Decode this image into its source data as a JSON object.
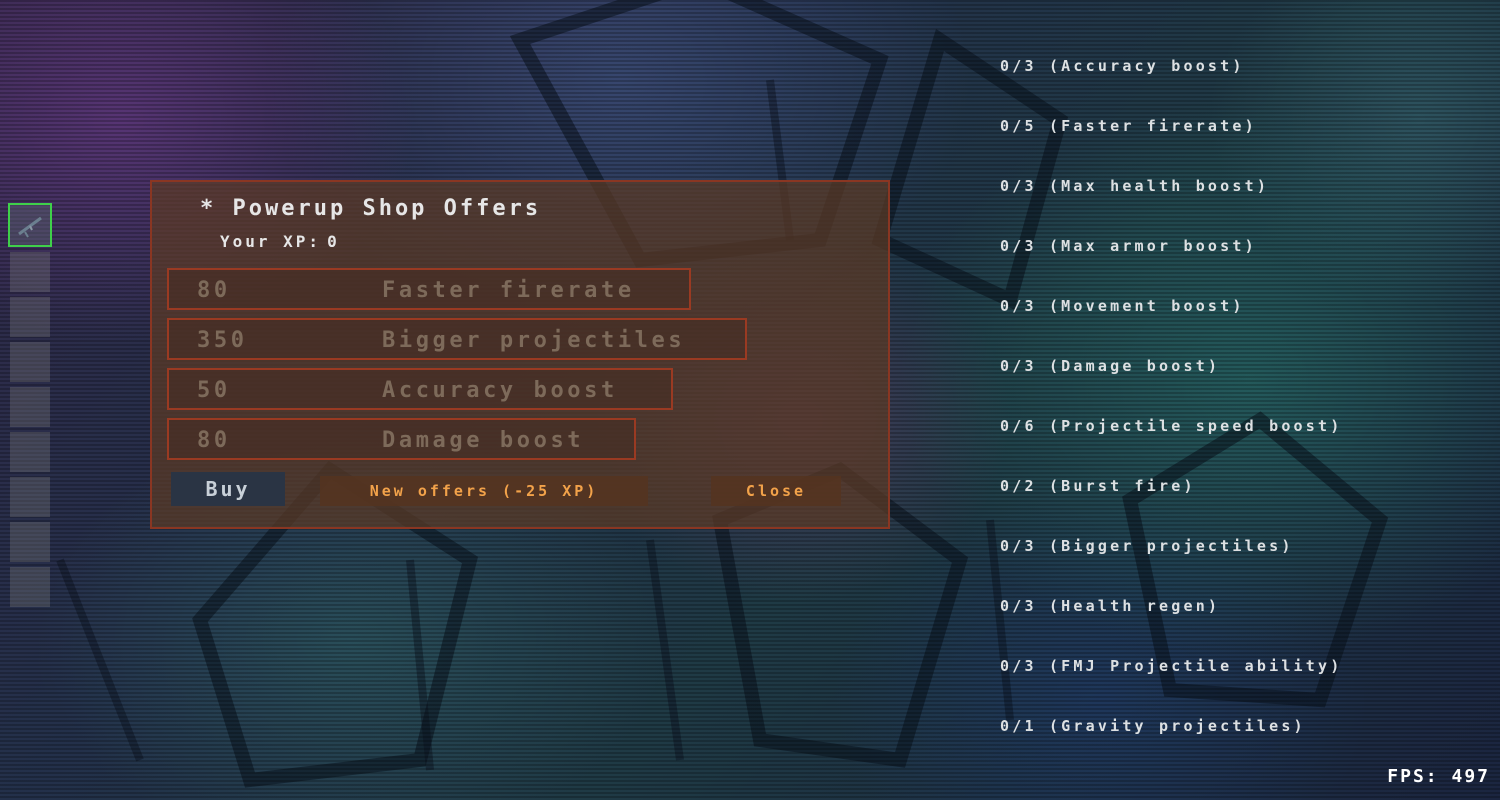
{
  "inventory": {
    "slot_count": 9,
    "selected_slot": 0,
    "selected_item_icon": "rifle-icon"
  },
  "stats": [
    {
      "level": "0/3",
      "name": "(Accuracy boost)"
    },
    {
      "level": "0/5",
      "name": "(Faster firerate)"
    },
    {
      "level": "0/3",
      "name": "(Max health boost)"
    },
    {
      "level": "0/3",
      "name": "(Max armor boost)"
    },
    {
      "level": "0/3",
      "name": "(Movement boost)"
    },
    {
      "level": "0/3",
      "name": "(Damage boost)"
    },
    {
      "level": "0/6",
      "name": "(Projectile speed boost)"
    },
    {
      "level": "0/2",
      "name": "(Burst fire)"
    },
    {
      "level": "0/3",
      "name": "(Bigger projectiles)"
    },
    {
      "level": "0/3",
      "name": "(Health regen)"
    },
    {
      "level": "0/3",
      "name": "(FMJ Projectile ability)"
    },
    {
      "level": "0/1",
      "name": "(Gravity projectiles)"
    }
  ],
  "shop": {
    "title": "* Powerup Shop Offers",
    "xp_label": "Your XP:",
    "xp_value": "0",
    "offers": [
      {
        "price": "80",
        "name": "Faster firerate"
      },
      {
        "price": "350",
        "name": "Bigger projectiles"
      },
      {
        "price": "50",
        "name": "Accuracy boost"
      },
      {
        "price": "80",
        "name": "Damage boost"
      }
    ],
    "buy_label": "Buy",
    "new_offers_label": "New offers (-25 XP)",
    "close_label": "Close"
  },
  "fps_text": "FPS: 497",
  "colors": {
    "panel_border": "#8a3622",
    "offer_text": "#7d6a5a",
    "button_text": "#f2a24a",
    "selected_slot_border": "#3fd04a"
  }
}
